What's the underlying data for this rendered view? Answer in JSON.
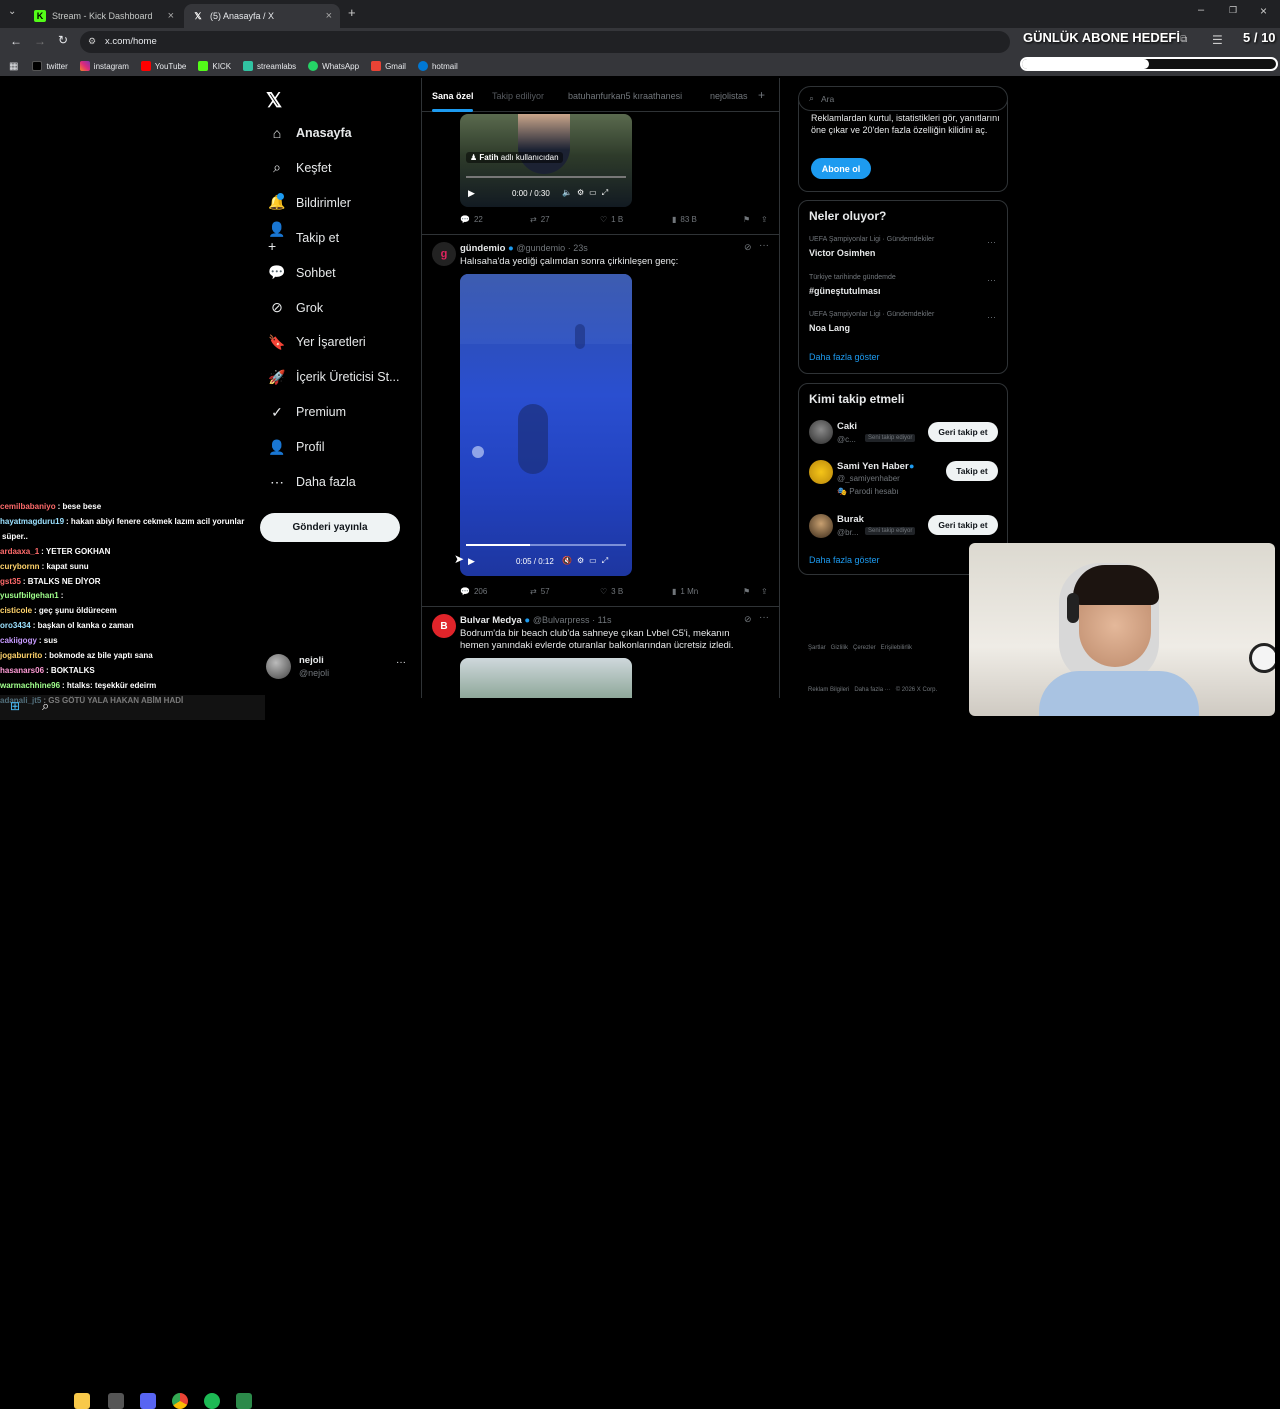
{
  "browser": {
    "tabs": [
      {
        "title": "Stream - Kick Dashboard"
      },
      {
        "title": "(5) Anasayfa / X"
      }
    ],
    "url": "x.com/home",
    "bookmarks": [
      "twitter",
      "instagram",
      "YouTube",
      "KICK",
      "streamlabs",
      "WhatsApp",
      "Gmail",
      "hotmail"
    ]
  },
  "overlay": {
    "goal_label": "GÜNLÜK ABONE HEDEFİ",
    "goal_count": "5 / 10",
    "goal_progress": 0.5
  },
  "x_nav": {
    "items": [
      "Anasayfa",
      "Keşfet",
      "Bildirimler",
      "Takip et",
      "Sohbet",
      "Grok",
      "Yer İşaretleri",
      "İçerik Üreticisi St...",
      "Premium",
      "Profil",
      "Daha fazla"
    ],
    "post_button": "Gönderi yayınla",
    "profile_name": "nejoli",
    "profile_handle": "@nejoli"
  },
  "feed": {
    "tabs": [
      "Sana özel",
      "Takip ediliyor",
      "batuhanfurkan5 kıraathanesi",
      "nejolistas"
    ],
    "tweet0": {
      "video_caption_name": "Fatih",
      "video_caption_rest": "adlı kullanıcıdan",
      "video_time": "0:00 / 0:30",
      "replies": "22",
      "retweets": "27",
      "likes": "1 B",
      "views": "83 B"
    },
    "tweet1": {
      "name": "gündemio",
      "handle": "@gundemio",
      "time": "· 23s",
      "text": "Halısaha'da yediği çalımdan sonra çirkinleşen genç:",
      "video_time": "0:05 / 0:12",
      "video_progress": 0.4,
      "replies": "206",
      "retweets": "57",
      "likes": "3 B",
      "views": "1 Mn"
    },
    "tweet2": {
      "name": "Bulvar Medya",
      "handle": "@Bulvarpress",
      "time": "· 11s",
      "text": "Bodrum'da bir beach club'da sahneye çıkan Lvbel C5'i, mekanın hemen yanındaki evlerde oturanlar balkonlarından ücretsiz izledi."
    }
  },
  "sidebar": {
    "search_placeholder": "Ara",
    "premium_text": "Reklamlardan kurtul, istatistikleri gör, yanıtlarını öne çıkar ve 20'den fazla özelliğin kilidini aç.",
    "premium_button": "Abone ol",
    "trends_title": "Neler oluyor?",
    "trends": [
      {
        "context": "UEFA Şampiyonlar Ligi · Gündemdekiler",
        "name": "Victor Osimhen"
      },
      {
        "context": "Türkiye tarihinde gündemde",
        "name": "#güneştutulması"
      },
      {
        "context": "UEFA Şampiyonlar Ligi · Gündemdekiler",
        "name": "Noa Lang"
      }
    ],
    "show_more": "Daha fazla göster",
    "who_title": "Kimi takip etmeli",
    "who": [
      {
        "name": "Caki",
        "handle": "@c...",
        "badge": "Seni takip ediyor",
        "button": "Geri takip et"
      },
      {
        "name": "Sami Yen Haber",
        "handle": "@_samiyenhaber",
        "sub": "Parodi hesabı",
        "button": "Takip et"
      },
      {
        "name": "Burak",
        "handle": "@br...",
        "badge": "Seni takip ediyor",
        "button": "Geri takip et"
      }
    ],
    "who_more": "Daha fazla göster",
    "footer1": "Şartlar   Gizlilik   Çerezler   Erişilebilirlik",
    "footer2": "Reklam Bilgileri   Daha fazla ···   © 2026 X Corp."
  },
  "chat": [
    {
      "user": "cemilbabaniyo",
      "msg": ": bese bese",
      "color": "#ff6b6b"
    },
    {
      "user": "hayatmagduru19",
      "msg": ": hakan abiyi fenere cekmek lazım acil yorunlar",
      "color": "#9be1ff"
    },
    {
      "user": "",
      "msg": "süper..",
      "color": "#fff"
    },
    {
      "user": "ardaaxa_1",
      "msg": ": YETER GOKHAN",
      "color": "#ff6b6b"
    },
    {
      "user": "curybornn",
      "msg": ": kapat sunu",
      "color": "#ffd36b"
    },
    {
      "user": "gst35",
      "msg": ": BTALKS NE DİYOR",
      "color": "#ff6b6b"
    },
    {
      "user": "yusufbilgehan1",
      "msg": ":",
      "color": "#a0ff8c"
    },
    {
      "user": "cisticole",
      "msg": ": geç şunu öldürecem",
      "color": "#ffd36b"
    },
    {
      "user": "oro3434",
      "msg": ": başkan ol kanka o zaman",
      "color": "#9be1ff"
    },
    {
      "user": "cakiigogy",
      "msg": ": sus",
      "color": "#c79bff"
    },
    {
      "user": "jogaburrito",
      "msg": ": bokmode az bile yaptı sana",
      "color": "#ffd36b"
    },
    {
      "user": "hasanars06",
      "msg": ": BOKTALKS",
      "color": "#ff9bd6"
    },
    {
      "user": "warmachhine96",
      "msg": ": htalks: teşekkür edeirm",
      "color": "#a0ff8c"
    },
    {
      "user": "adanali_jt5",
      "msg": ": GS GÖTÜ YALA HAKAN ABİM HADİ",
      "color": "#9be1ff"
    }
  ],
  "colors": {
    "accent": "#1d9bf0",
    "bg": "#000000",
    "border": "#2f3336",
    "kick": "#53fc18"
  }
}
